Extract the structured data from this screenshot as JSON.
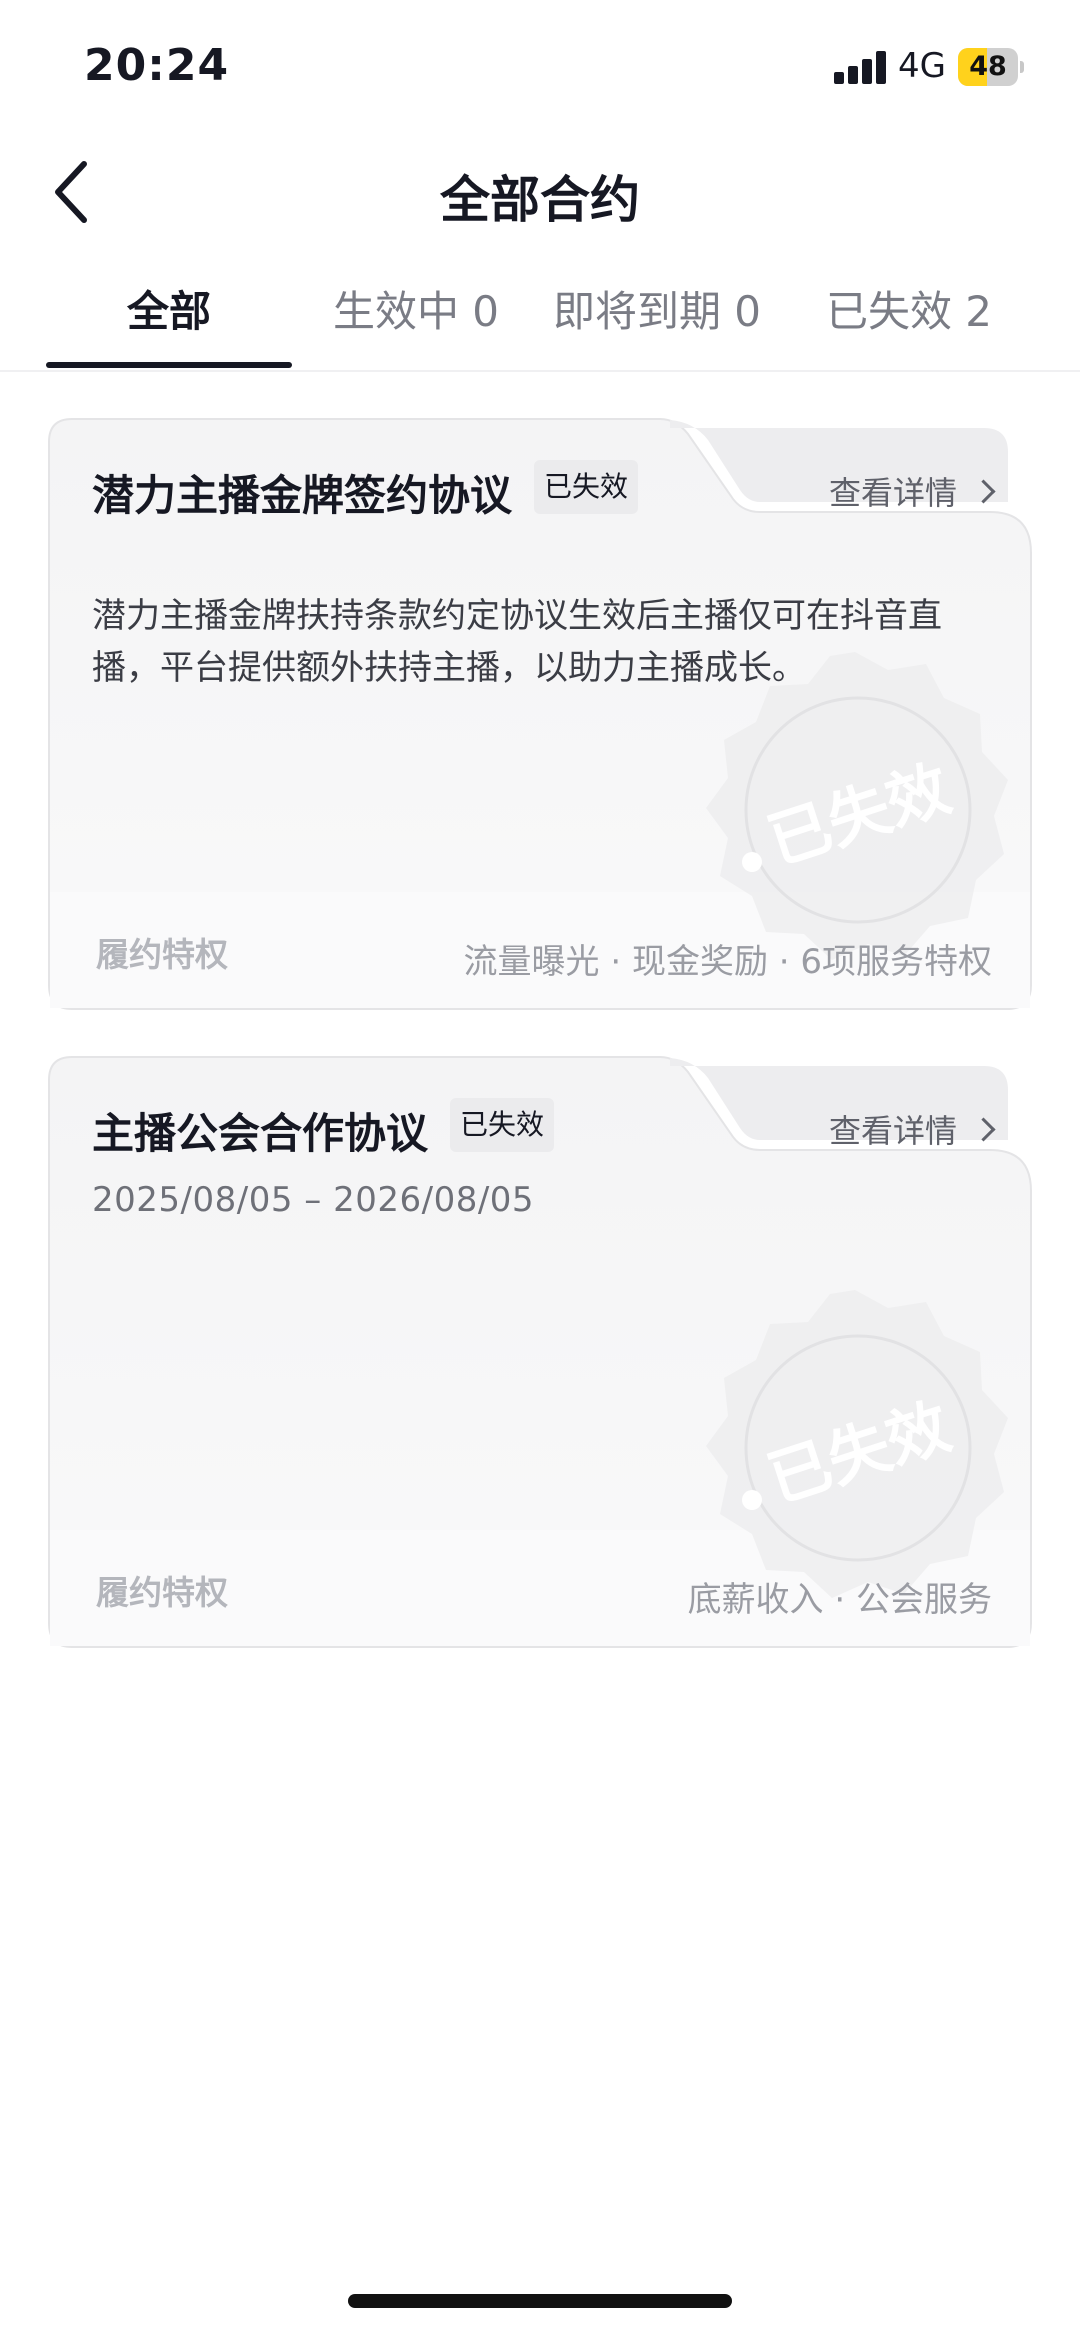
{
  "status_bar": {
    "time": "20:24",
    "network": "4G",
    "battery": "48",
    "battery_level": 0.48,
    "battery_color": "#ffd21c"
  },
  "nav": {
    "back_icon": "chevron-left-icon",
    "title": "全部合约"
  },
  "tabs": [
    {
      "label": "全部",
      "active": true
    },
    {
      "label": "生效中 0",
      "active": false
    },
    {
      "label": "即将到期 0",
      "active": false
    },
    {
      "label": "已失效 2",
      "active": false
    }
  ],
  "contracts": [
    {
      "title": "潜力主播金牌签约协议",
      "status": "已失效",
      "detail_link": "查看详情",
      "description": "潜力主播金牌扶持条款约定协议生效后主播仅可在抖音直播，平台提供额外扶持主播，以助力主播成长。",
      "stamp_text": "已失效",
      "footer_label": "履约特权",
      "perks": "流量曝光 · 现金奖励 · 6项服务特权"
    },
    {
      "title": "主播公会合作协议",
      "status": "已失效",
      "detail_link": "查看详情",
      "dates": "2025/08/05 – 2026/08/05",
      "stamp_text": "已失效",
      "footer_label": "履约特权",
      "perks": "底薪收入 · 公会服务"
    }
  ]
}
